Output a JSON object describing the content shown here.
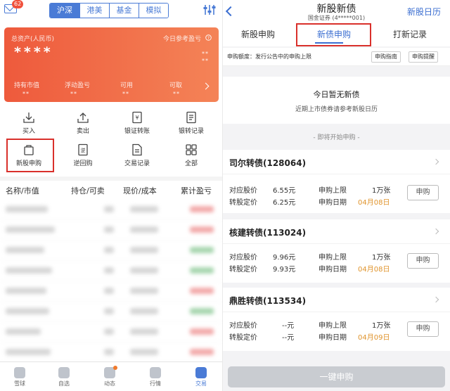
{
  "left": {
    "mail_badge": "62",
    "market_tabs": [
      "沪深",
      "港美",
      "基金",
      "模拟"
    ],
    "asset": {
      "total_label": "总资产(人民币)",
      "ref_pnl_label": "今日参考盈亏",
      "total_value": "****",
      "ref_pnl_value": "**",
      "ref_pnl_value2": "**",
      "holding_mv_label": "持有市值",
      "floating_pnl_label": "浮动盈亏",
      "available_label": "可用",
      "withdrawable_label": "可取",
      "holding_mv_value": "**",
      "floating_pnl_value": "**",
      "available_value": "**",
      "withdrawable_value": "**"
    },
    "functions": [
      "买入",
      "卖出",
      "银证转账",
      "银转记录",
      "新股申购",
      "逆回购",
      "交易记录",
      "全部"
    ],
    "table_headers": [
      "名称/市值",
      "持仓/可卖",
      "现价/成本",
      "累计盈亏"
    ],
    "bottom_nav": [
      "雪球",
      "自选",
      "动态",
      "行情",
      "交易"
    ]
  },
  "right": {
    "title": "新股新债",
    "subtitle": "国金证券 (4*****001)",
    "calendar_link": "新股日历",
    "tabs": [
      "新股申购",
      "新债申购",
      "打新记录"
    ],
    "quota_text": "申购额度：发行公告中的申购上限",
    "guide_button": "申购指南",
    "reminder_button": "申购提醒",
    "no_bond_title": "今日暂无新债",
    "no_bond_sub": "近期上市债券请参考新股日历",
    "upcoming_label": "- 即将开始申购 -",
    "bonds": [
      {
        "name": "司尔转债(128064)",
        "stock_price": "6.55元",
        "conv_price": "6.25元",
        "limit": "1万张",
        "date": "04月08日"
      },
      {
        "name": "核建转债(113024)",
        "stock_price": "9.96元",
        "conv_price": "9.93元",
        "limit": "1万张",
        "date": "04月08日"
      },
      {
        "name": "鼎胜转债(113534)",
        "stock_price": "--元",
        "conv_price": "--元",
        "limit": "1万张",
        "date": "04月09日"
      }
    ],
    "labels": {
      "stock_price": "对应股价",
      "conv_price": "转股定价",
      "limit": "申购上限",
      "date": "申购日期",
      "subscribe": "申购"
    },
    "onekey_button": "一键申购"
  }
}
